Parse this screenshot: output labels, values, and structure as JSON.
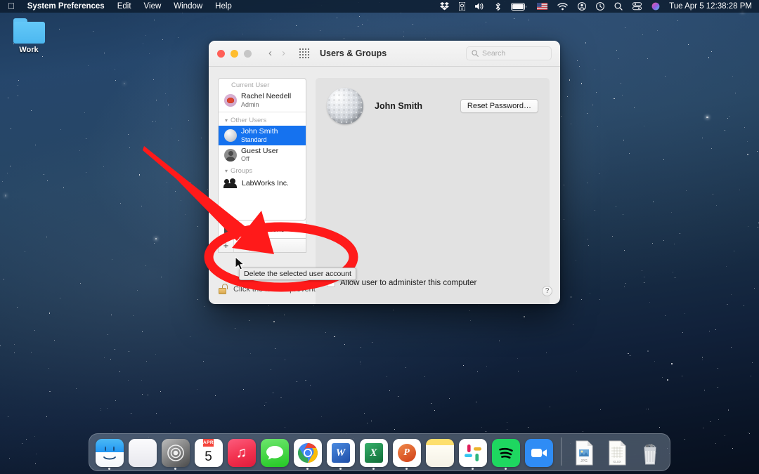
{
  "menubar": {
    "apple_glyph": "",
    "items": [
      {
        "label": "System Preferences",
        "bold": true
      },
      {
        "label": "Edit",
        "bold": false
      },
      {
        "label": "View",
        "bold": false
      },
      {
        "label": "Window",
        "bold": false
      },
      {
        "label": "Help",
        "bold": false
      }
    ],
    "status_icons": [
      "dropbox-icon",
      "time-machine-icon",
      "volume-icon",
      "bluetooth-icon",
      "battery-icon",
      "keyboard-flag-icon",
      "wifi-icon",
      "user-account-icon",
      "clock-icon",
      "spotlight-search-icon",
      "control-center-icon",
      "siri-icon"
    ],
    "clock": "Tue Apr 5  12:38:28 PM"
  },
  "desktop": {
    "folder": {
      "label": "Work",
      "icon": "folder-icon"
    }
  },
  "window": {
    "title": "Users & Groups",
    "traffic_lights": [
      "close",
      "minimize",
      "zoom"
    ],
    "nav": {
      "back": "‹",
      "forward": "›",
      "grid": "all-preferences-icon"
    },
    "search": {
      "placeholder": "Search",
      "value": ""
    },
    "sidebar": {
      "groups": [
        {
          "header": "Current User",
          "collapsible": false,
          "rows": [
            {
              "name": "Rachel Needell",
              "sub": "Admin",
              "avatar": "rachel-avatar",
              "selected": false
            }
          ]
        },
        {
          "header": "Other Users",
          "collapsible": true,
          "rows": [
            {
              "name": "John Smith",
              "sub": "Standard",
              "avatar": "john-avatar",
              "selected": true
            },
            {
              "name": "Guest User",
              "sub": "Off",
              "avatar": "guest-avatar",
              "selected": false
            }
          ]
        },
        {
          "header": "Groups",
          "collapsible": true,
          "rows": [
            {
              "name": "LabWorks Inc.",
              "sub": "",
              "avatar": "group-icon",
              "selected": false
            }
          ]
        }
      ],
      "login_options": {
        "label": "Login Options",
        "icon": "login-options-icon"
      },
      "toolbar": {
        "add_label": "+",
        "remove_label": "−",
        "add_name": "add-user-button",
        "remove_name": "delete-user-button"
      }
    },
    "detail": {
      "user_name": "John Smith",
      "avatar": "golf-ball-avatar",
      "reset_password_label": "Reset Password…",
      "admin_checkbox": {
        "label": "Allow user to administer this computer",
        "checked": false
      },
      "help_label": "?"
    },
    "lock": {
      "text": "Click the lock to prevent further changes.",
      "icon": "unlocked-padlock-icon"
    }
  },
  "tooltip": {
    "text": "Delete the selected user account"
  },
  "annotation": {
    "color": "#FF1A1A",
    "arrow": "red-arrow-pointing-to-delete-button",
    "circle": "red-oval-highlighting-add-remove-toolbar"
  },
  "dock": {
    "items": [
      {
        "name": "finder",
        "label": "Finder",
        "running": true
      },
      {
        "name": "launchpad",
        "label": "Launchpad",
        "running": false
      },
      {
        "name": "system-preferences",
        "label": "System Preferences",
        "running": true
      },
      {
        "name": "calendar",
        "label": "Calendar",
        "running": false,
        "month": "APR",
        "day": "5"
      },
      {
        "name": "music",
        "label": "Music",
        "running": false
      },
      {
        "name": "messages",
        "label": "Messages",
        "running": false
      },
      {
        "name": "chrome",
        "label": "Google Chrome",
        "running": true
      },
      {
        "name": "word",
        "label": "Microsoft Word",
        "running": true,
        "glyph": "W"
      },
      {
        "name": "excel",
        "label": "Microsoft Excel",
        "running": true,
        "glyph": "X"
      },
      {
        "name": "powerpoint",
        "label": "Microsoft PowerPoint",
        "running": true,
        "glyph": "P"
      },
      {
        "name": "notes",
        "label": "Notes",
        "running": false
      },
      {
        "name": "slack",
        "label": "Slack",
        "running": true
      },
      {
        "name": "spotify",
        "label": "Spotify",
        "running": true
      },
      {
        "name": "zoom",
        "label": "Zoom",
        "running": false
      }
    ],
    "files": [
      {
        "name": "jpg-file",
        "label": "JPG"
      },
      {
        "name": "xlsx-file",
        "label": "XLSX"
      }
    ],
    "trash": {
      "name": "trash",
      "label": "Trash"
    }
  }
}
